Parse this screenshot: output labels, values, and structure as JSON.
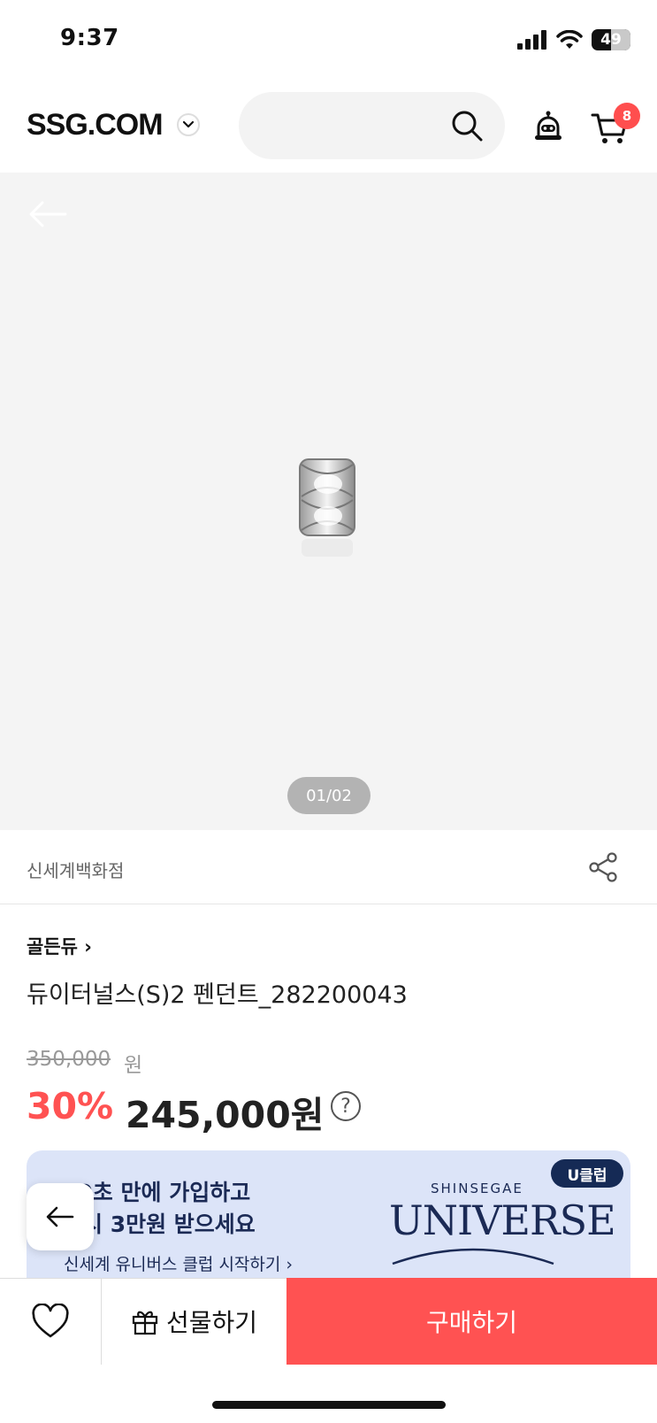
{
  "status": {
    "time": "9:37",
    "battery": "49"
  },
  "header": {
    "logo": "SSG.COM",
    "cart_count": "8",
    "search_placeholder": ""
  },
  "gallery": {
    "pager": "01/02"
  },
  "product": {
    "store": "신세계백화점",
    "brand": "골든듀",
    "brand_chevron": "›",
    "title": "듀이터널스(S)2 펜던트_282200043",
    "original_price": "350,000",
    "original_currency": "원",
    "discount": "30%",
    "price": "245,000원",
    "help_glyph": "?"
  },
  "banner": {
    "line1": "10초 만에 가입하고",
    "line2": "즉시 3만원 받으세요",
    "link": "신세계 유니버스 클럽 시작하기 ›",
    "badge": "U클럽",
    "shinsegae": "SHINSEGAE",
    "universe": "UNIVERSE"
  },
  "bottom_bar": {
    "gift_label": "선물하기",
    "buy_label": "구매하기"
  },
  "icons": [
    "signal-icon",
    "wifi-icon",
    "battery-icon",
    "chevron-down-icon",
    "search-icon",
    "alarm-icon",
    "cart-icon",
    "back-arrow-icon",
    "share-icon",
    "help-icon",
    "heart-icon",
    "gift-icon"
  ],
  "colors": {
    "accent": "#ff5252",
    "banner_bg": "#dce4f8",
    "banner_text": "#1b2a55"
  }
}
